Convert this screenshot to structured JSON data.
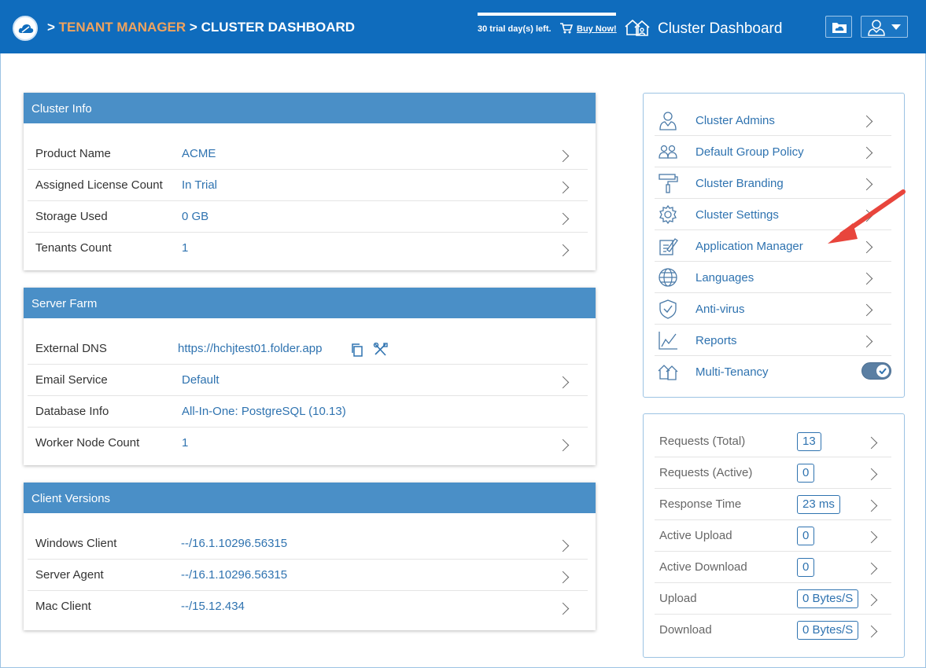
{
  "header": {
    "breadcrumb_sep1": ">",
    "breadcrumb_link": "TENANT MANAGER",
    "breadcrumb_sep2": ">",
    "breadcrumb_current": "CLUSTER DASHBOARD",
    "trial_text": "30 trial day(s) left.",
    "buy_now": "Buy Now!",
    "page_title": "Cluster Dashboard",
    "colors": {
      "bar": "#0f6cbd",
      "breadcrumb_link": "#f0a35e"
    }
  },
  "cluster_info": {
    "title": "Cluster Info",
    "rows": [
      {
        "label": "Product Name",
        "value": "ACME"
      },
      {
        "label": "Assigned License Count",
        "value": "In Trial"
      },
      {
        "label": "Storage Used",
        "value": "0 GB"
      },
      {
        "label": "Tenants Count",
        "value": "1"
      }
    ]
  },
  "server_farm": {
    "title": "Server Farm",
    "rows": [
      {
        "label": "External DNS",
        "value": "https://hchjtest01.folder.app"
      },
      {
        "label": "Email Service",
        "value": "Default"
      },
      {
        "label": "Database Info",
        "value": "All-In-One: PostgreSQL (10.13)"
      },
      {
        "label": "Worker Node Count",
        "value": "1"
      }
    ]
  },
  "client_versions": {
    "title": "Client Versions",
    "rows": [
      {
        "label": "Windows Client",
        "value": "--/16.1.10296.56315"
      },
      {
        "label": "Server Agent",
        "value": "--/16.1.10296.56315"
      },
      {
        "label": "Mac Client",
        "value": "--/15.12.434"
      }
    ]
  },
  "admin_menu": {
    "items": [
      {
        "label": "Cluster Admins",
        "icon": "admin-icon"
      },
      {
        "label": "Default Group Policy",
        "icon": "group-icon"
      },
      {
        "label": "Cluster Branding",
        "icon": "paint-roller-icon"
      },
      {
        "label": "Cluster Settings",
        "icon": "gear-icon"
      },
      {
        "label": "Application Manager",
        "icon": "app-manager-icon"
      },
      {
        "label": "Languages",
        "icon": "globe-icon"
      },
      {
        "label": "Anti-virus",
        "icon": "shield-icon"
      },
      {
        "label": "Reports",
        "icon": "chart-icon"
      },
      {
        "label": "Multi-Tenancy",
        "icon": "houses-icon",
        "toggle": true
      }
    ]
  },
  "metrics": {
    "rows": [
      {
        "label": "Requests (Total)",
        "value": "13"
      },
      {
        "label": "Requests (Active)",
        "value": "0"
      },
      {
        "label": "Response Time",
        "value": "23 ms"
      },
      {
        "label": "Active Upload",
        "value": "0"
      },
      {
        "label": "Active Download",
        "value": "0"
      },
      {
        "label": "Upload",
        "value": "0 Bytes/S"
      },
      {
        "label": "Download",
        "value": "0 Bytes/S"
      }
    ]
  }
}
